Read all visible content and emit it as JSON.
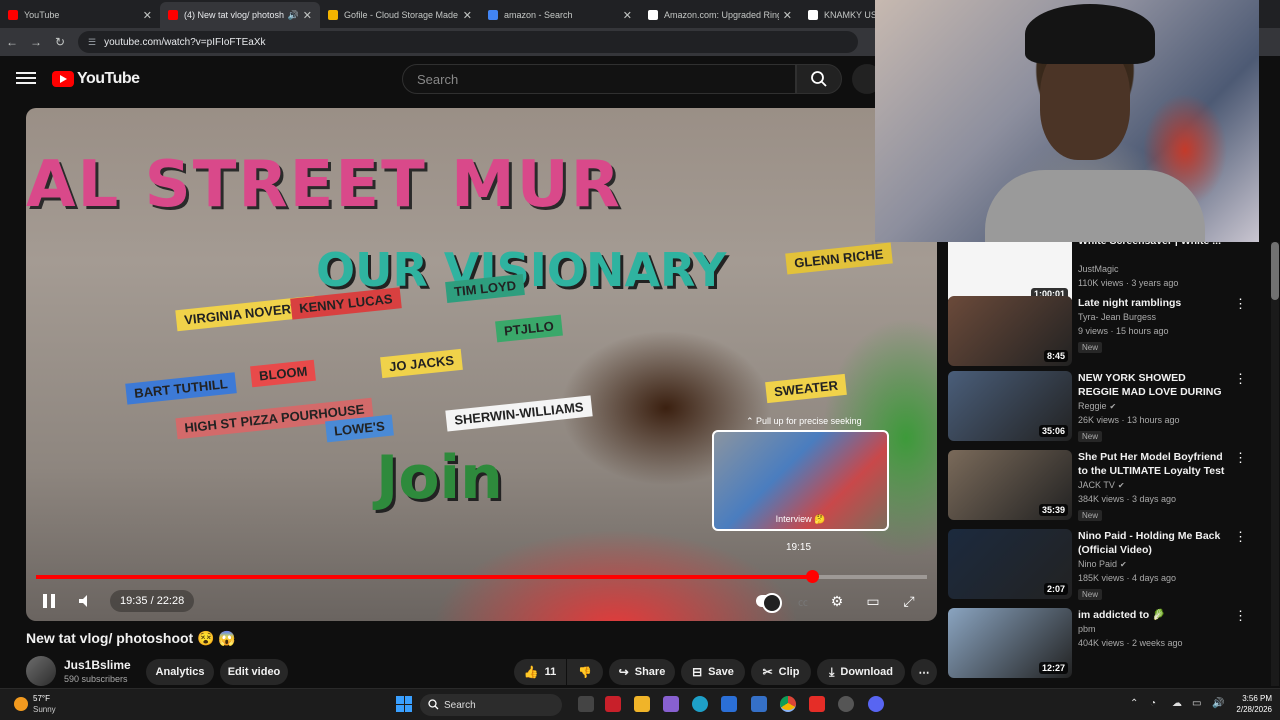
{
  "browser": {
    "tabs": [
      {
        "label": "YouTube",
        "color": "#ff0000",
        "active": false
      },
      {
        "label": "(4) New tat vlog/ photosho",
        "color": "#ff0000",
        "active": true
      },
      {
        "label": "Gofile - Cloud Storage Made Si",
        "color": "#f4b400",
        "active": false
      },
      {
        "label": "amazon - Search",
        "color": "#4285f4",
        "active": false
      },
      {
        "label": "Amazon.com: Upgraded Ring L",
        "color": "#ffffff",
        "active": false
      },
      {
        "label": "KNAMKY USB",
        "color": "#ffffff",
        "active": false
      }
    ],
    "url": "youtube.com/watch?v=pIFIoFTEaXk"
  },
  "header": {
    "logo_text": "YouTube",
    "search_placeholder": "Search"
  },
  "player": {
    "pull_hint": "Pull up for precise seeking",
    "preview_title": "Interview 🤔",
    "preview_time": "19:15",
    "time_display": "19:35 / 22:28",
    "progress_fraction": 0.871,
    "graffiti": {
      "line1": "AL STREET MUR",
      "line2": "OUR VISIONARY",
      "join": "Join"
    },
    "ribbons": [
      "VIRGINIA NOVERTY",
      "BART TUTHILL",
      "BLOOM",
      "JO JACKS",
      "PTJLLO",
      "HIGH ST PIZZA POURHOUSE",
      "LOWE'S",
      "SHERWIN-WILLIAMS",
      "SWEATER",
      "GLENN RICHE",
      "KENNY LUCAS",
      "TIM LOYD"
    ]
  },
  "video": {
    "title": "New tat vlog/ photoshoot 😵 😱",
    "channel": "Jus1Bslime",
    "subscribers": "590 subscribers",
    "buttons": {
      "analytics": "Analytics",
      "edit": "Edit video",
      "likes": "11",
      "share": "Share",
      "save": "Save",
      "clip": "Clip",
      "download": "Download"
    }
  },
  "recommendations": [
    {
      "title": "White Screensaver | White ...",
      "channel": "JustMagic",
      "verified": false,
      "meta": "110K views · 3 years ago",
      "duration": "1:00:01",
      "badge": "",
      "thumb": "#f5f5f5"
    },
    {
      "title": "Late night ramblings",
      "channel": "Tyra- Jean Burgess",
      "verified": false,
      "meta": "9 views · 15 hours ago",
      "duration": "8:45",
      "badge": "New",
      "thumb": "#6b4a3a"
    },
    {
      "title": "NEW YORK SHOWED REGGIE MAD LOVE DURING HIS TIME ...",
      "channel": "Reggie",
      "verified": true,
      "meta": "26K views · 13 hours ago",
      "duration": "35:06",
      "badge": "New",
      "thumb": "#4a5e7a"
    },
    {
      "title": "She Put Her Model Boyfriend to the ULTIMATE Loyalty Test 😨 ...",
      "channel": "JACK TV",
      "verified": true,
      "meta": "384K views · 3 days ago",
      "duration": "35:39",
      "badge": "New",
      "thumb": "#7a6a5a"
    },
    {
      "title": "Nino Paid - Holding Me Back (Official Video)",
      "channel": "Nino Paid",
      "verified": true,
      "meta": "185K views · 4 days ago",
      "duration": "2:07",
      "badge": "New",
      "thumb": "#1c2a3e"
    },
    {
      "title": "im addicted to 🥬",
      "channel": "pbm",
      "verified": false,
      "meta": "404K views · 2 weeks ago",
      "duration": "12:27",
      "badge": "",
      "thumb": "#8aa4c0"
    }
  ],
  "taskbar": {
    "temperature": "57°F",
    "condition": "Sunny",
    "search_label": "Search",
    "time": "3:56 PM",
    "date": "2/28/2026"
  }
}
